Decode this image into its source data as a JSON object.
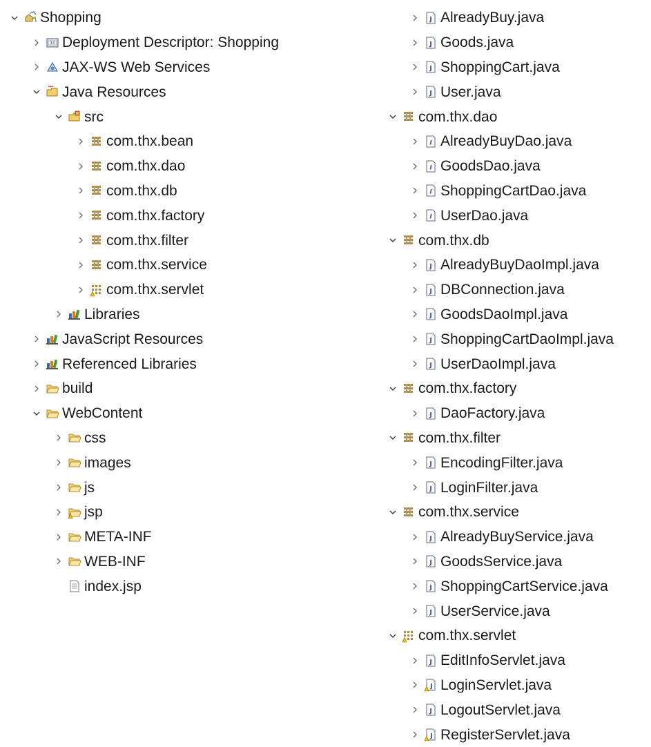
{
  "explorer": {
    "left_items": [
      {
        "label": "Shopping",
        "icon": "project-icon",
        "level": 0,
        "twisty": "expanded"
      },
      {
        "label": "Deployment Descriptor: Shopping",
        "icon": "deployment-descriptor-icon",
        "level": 1,
        "twisty": "collapsed"
      },
      {
        "label": "JAX-WS Web Services",
        "icon": "web-services-icon",
        "level": 1,
        "twisty": "collapsed"
      },
      {
        "label": "Java Resources",
        "icon": "java-resources-icon",
        "level": 1,
        "twisty": "expanded"
      },
      {
        "label": "src",
        "icon": "source-folder-icon",
        "level": 2,
        "twisty": "expanded"
      },
      {
        "label": "com.thx.bean",
        "icon": "package-icon",
        "level": 3,
        "twisty": "collapsed"
      },
      {
        "label": "com.thx.dao",
        "icon": "package-icon",
        "level": 3,
        "twisty": "collapsed"
      },
      {
        "label": "com.thx.db",
        "icon": "package-icon",
        "level": 3,
        "twisty": "collapsed"
      },
      {
        "label": "com.thx.factory",
        "icon": "package-icon",
        "level": 3,
        "twisty": "collapsed"
      },
      {
        "label": "com.thx.filter",
        "icon": "package-icon",
        "level": 3,
        "twisty": "collapsed"
      },
      {
        "label": "com.thx.service",
        "icon": "package-icon",
        "level": 3,
        "twisty": "collapsed"
      },
      {
        "label": "com.thx.servlet",
        "icon": "package-warning-icon",
        "level": 3,
        "twisty": "collapsed"
      },
      {
        "label": "Libraries",
        "icon": "library-icon",
        "level": 2,
        "twisty": "collapsed"
      },
      {
        "label": "JavaScript Resources",
        "icon": "library-icon",
        "level": 1,
        "twisty": "collapsed"
      },
      {
        "label": "Referenced Libraries",
        "icon": "library-icon",
        "level": 1,
        "twisty": "collapsed"
      },
      {
        "label": "build",
        "icon": "folder-icon",
        "level": 1,
        "twisty": "collapsed"
      },
      {
        "label": "WebContent",
        "icon": "folder-open-icon",
        "level": 1,
        "twisty": "expanded"
      },
      {
        "label": "css",
        "icon": "folder-icon",
        "level": 2,
        "twisty": "collapsed"
      },
      {
        "label": "images",
        "icon": "folder-icon",
        "level": 2,
        "twisty": "collapsed"
      },
      {
        "label": "js",
        "icon": "folder-icon",
        "level": 2,
        "twisty": "collapsed"
      },
      {
        "label": "jsp",
        "icon": "folder-warning-icon",
        "level": 2,
        "twisty": "collapsed"
      },
      {
        "label": "META-INF",
        "icon": "folder-icon",
        "level": 2,
        "twisty": "collapsed"
      },
      {
        "label": "WEB-INF",
        "icon": "folder-icon",
        "level": 2,
        "twisty": "collapsed"
      },
      {
        "label": "index.jsp",
        "icon": "jsp-file-icon",
        "level": 2,
        "twisty": "none"
      }
    ],
    "right_items": [
      {
        "label": "AlreadyBuy.java",
        "icon": "java-file-icon",
        "level": 1,
        "twisty": "collapsed"
      },
      {
        "label": "Goods.java",
        "icon": "java-file-icon",
        "level": 1,
        "twisty": "collapsed"
      },
      {
        "label": "ShoppingCart.java",
        "icon": "java-file-icon",
        "level": 1,
        "twisty": "collapsed"
      },
      {
        "label": "User.java",
        "icon": "java-file-icon",
        "level": 1,
        "twisty": "collapsed"
      },
      {
        "label": "com.thx.dao",
        "icon": "package-icon",
        "level": 0,
        "twisty": "expanded"
      },
      {
        "label": "AlreadyBuyDao.java",
        "icon": "java-interface-icon",
        "level": 1,
        "twisty": "collapsed"
      },
      {
        "label": "GoodsDao.java",
        "icon": "java-interface-icon",
        "level": 1,
        "twisty": "collapsed"
      },
      {
        "label": "ShoppingCartDao.java",
        "icon": "java-interface-icon",
        "level": 1,
        "twisty": "collapsed"
      },
      {
        "label": "UserDao.java",
        "icon": "java-interface-icon",
        "level": 1,
        "twisty": "collapsed"
      },
      {
        "label": "com.thx.db",
        "icon": "package-icon",
        "level": 0,
        "twisty": "expanded"
      },
      {
        "label": "AlreadyBuyDaoImpl.java",
        "icon": "java-file-icon",
        "level": 1,
        "twisty": "collapsed"
      },
      {
        "label": "DBConnection.java",
        "icon": "java-file-icon",
        "level": 1,
        "twisty": "collapsed"
      },
      {
        "label": "GoodsDaoImpl.java",
        "icon": "java-file-icon",
        "level": 1,
        "twisty": "collapsed"
      },
      {
        "label": "ShoppingCartDaoImpl.java",
        "icon": "java-file-icon",
        "level": 1,
        "twisty": "collapsed"
      },
      {
        "label": "UserDaoImpl.java",
        "icon": "java-file-icon",
        "level": 1,
        "twisty": "collapsed"
      },
      {
        "label": "com.thx.factory",
        "icon": "package-icon",
        "level": 0,
        "twisty": "expanded"
      },
      {
        "label": "DaoFactory.java",
        "icon": "java-file-icon",
        "level": 1,
        "twisty": "collapsed"
      },
      {
        "label": "com.thx.filter",
        "icon": "package-icon",
        "level": 0,
        "twisty": "expanded"
      },
      {
        "label": "EncodingFilter.java",
        "icon": "java-file-icon",
        "level": 1,
        "twisty": "collapsed"
      },
      {
        "label": "LoginFilter.java",
        "icon": "java-file-icon",
        "level": 1,
        "twisty": "collapsed"
      },
      {
        "label": "com.thx.service",
        "icon": "package-icon",
        "level": 0,
        "twisty": "expanded"
      },
      {
        "label": "AlreadyBuyService.java",
        "icon": "java-file-icon",
        "level": 1,
        "twisty": "collapsed"
      },
      {
        "label": "GoodsService.java",
        "icon": "java-file-icon",
        "level": 1,
        "twisty": "collapsed"
      },
      {
        "label": "ShoppingCartService.java",
        "icon": "java-file-icon",
        "level": 1,
        "twisty": "collapsed"
      },
      {
        "label": "UserService.java",
        "icon": "java-file-icon",
        "level": 1,
        "twisty": "collapsed"
      },
      {
        "label": "com.thx.servlet",
        "icon": "package-warning-icon",
        "level": 0,
        "twisty": "expanded"
      },
      {
        "label": "EditInfoServlet.java",
        "icon": "java-file-icon",
        "level": 1,
        "twisty": "collapsed"
      },
      {
        "label": "LoginServlet.java",
        "icon": "java-file-warning-icon",
        "level": 1,
        "twisty": "collapsed"
      },
      {
        "label": "LogoutServlet.java",
        "icon": "java-file-icon",
        "level": 1,
        "twisty": "collapsed"
      },
      {
        "label": "RegisterServlet.java",
        "icon": "java-file-warning-icon",
        "level": 1,
        "twisty": "collapsed"
      }
    ]
  }
}
